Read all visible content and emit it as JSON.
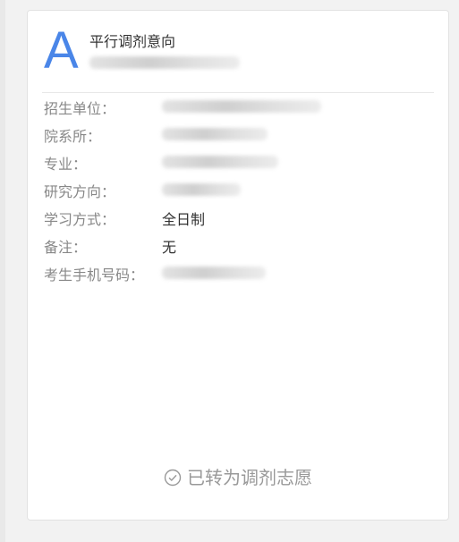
{
  "card": {
    "letter": "A",
    "title": "平行调剂意向",
    "fields": [
      {
        "label": "招生单位：",
        "value": ""
      },
      {
        "label": "院系所：",
        "value": ""
      },
      {
        "label": "专业：",
        "value": ""
      },
      {
        "label": "研究方向：",
        "value": ""
      },
      {
        "label": "学习方式：",
        "value": "全日制"
      },
      {
        "label": "备注：",
        "value": "无"
      },
      {
        "label": "考生手机号码：",
        "value": ""
      }
    ],
    "status": "已转为调剂志愿",
    "status_icon": "check-circle-icon"
  },
  "colors": {
    "accent": "#4a86e8",
    "label": "#888888",
    "value": "#333333",
    "status": "#999999"
  }
}
